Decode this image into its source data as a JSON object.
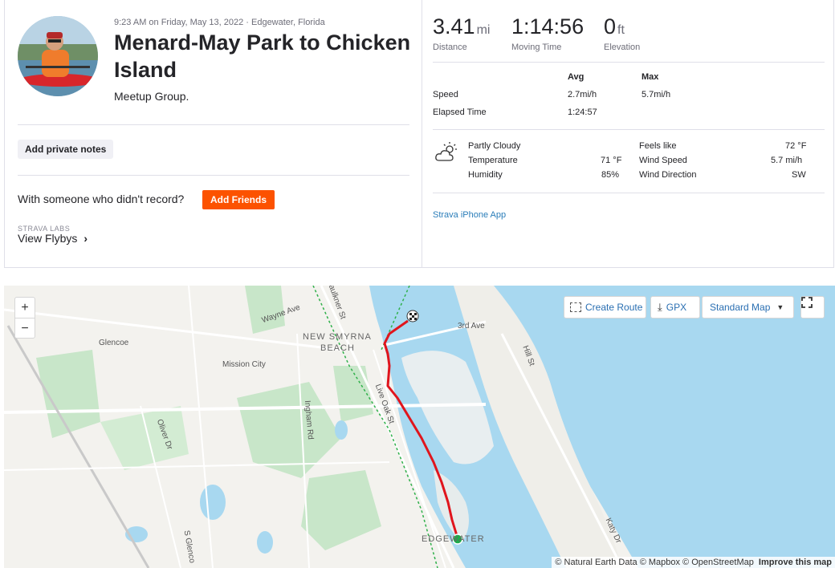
{
  "activity": {
    "meta": "9:23 AM on Friday, May 13, 2022 · Edgewater, Florida",
    "title": "Menard-May Park to Chicken Island",
    "description": "Meetup Group.",
    "add_notes_label": "Add private notes",
    "with_someone_text": "With someone who didn't record?",
    "add_friends_label": "Add Friends",
    "labs_label": "STRAVA LABS",
    "flybys_label": "View Flybys",
    "app_link": "Strava iPhone App"
  },
  "stats": {
    "distance": {
      "value": "3.41",
      "unit": "mi",
      "label": "Distance"
    },
    "moving_time": {
      "value": "1:14:56",
      "label": "Moving Time"
    },
    "elevation": {
      "value": "0",
      "unit": "ft",
      "label": "Elevation"
    },
    "avg_header": "Avg",
    "max_header": "Max",
    "speed_label": "Speed",
    "speed_avg": "2.7mi/h",
    "speed_max": "5.7mi/h",
    "elapsed_label": "Elapsed Time",
    "elapsed_avg": "1:24:57"
  },
  "weather": {
    "icon": "partly-cloudy-icon",
    "condition": "Partly Cloudy",
    "temperature_label": "Temperature",
    "temperature_value": "71 °F",
    "humidity_label": "Humidity",
    "humidity_value": "85%",
    "feels_like_label": "Feels like",
    "feels_like_value": "72 °F",
    "wind_speed_label": "Wind Speed",
    "wind_speed_value": "5.7 mi/h",
    "wind_direction_label": "Wind Direction",
    "wind_direction_value": "SW"
  },
  "map": {
    "zoom_in": "+",
    "zoom_out": "−",
    "create_route": "Create Route",
    "gpx": "GPX",
    "map_style": "Standard Map",
    "attribution": "© Natural Earth Data © Mapbox © OpenStreetMap",
    "improve": "Improve this map",
    "labels": {
      "wayne_ave": "Wayne Ave",
      "glencoe": "Glencoe",
      "new_smyrna": "NEW SMYRNA",
      "beach": "BEACH",
      "third_ave": "3rd Ave",
      "hill_st": "Hill St",
      "mission_city": "Mission City",
      "live_oak": "Live Oak St",
      "ingham": "Ingham Rd",
      "oliver": "Oliver Dr",
      "s_glenco": "S Glenco",
      "katy": "Katy Dr",
      "faulkner": "Faulkner St",
      "edgewater": "EDGEWATER"
    },
    "colors": {
      "route": "#e0151d",
      "water": "#a8d8f0",
      "park": "#c8e6c9",
      "start": "#1cae4a"
    }
  }
}
